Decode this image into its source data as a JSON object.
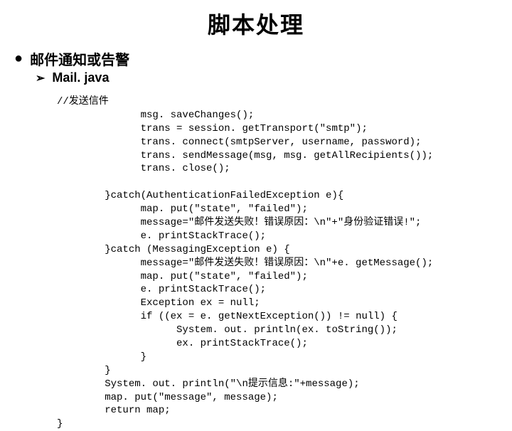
{
  "title": "脚本处理",
  "bullet": "邮件通知或告警",
  "sub": "Mail. java",
  "code": "//发送信件\n              msg. saveChanges();\n              trans = session. getTransport(\"smtp\");\n              trans. connect(smtpServer, username, password);\n              trans. sendMessage(msg, msg. getAllRecipients());\n              trans. close();\n\n        }catch(AuthenticationFailedException e){\n              map. put(\"state\", \"failed\");\n              message=\"邮件发送失败！错误原因：\\n\"+\"身份验证错误!\";\n              e. printStackTrace();\n        }catch (MessagingException e) {\n              message=\"邮件发送失败！错误原因：\\n\"+e. getMessage();\n              map. put(\"state\", \"failed\");\n              e. printStackTrace();\n              Exception ex = null;\n              if ((ex = e. getNextException()) != null) {\n                    System. out. println(ex. toString());\n                    ex. printStackTrace();\n              }\n        }\n        System. out. println(\"\\n提示信息:\"+message);\n        map. put(\"message\", message);\n        return map;\n}"
}
